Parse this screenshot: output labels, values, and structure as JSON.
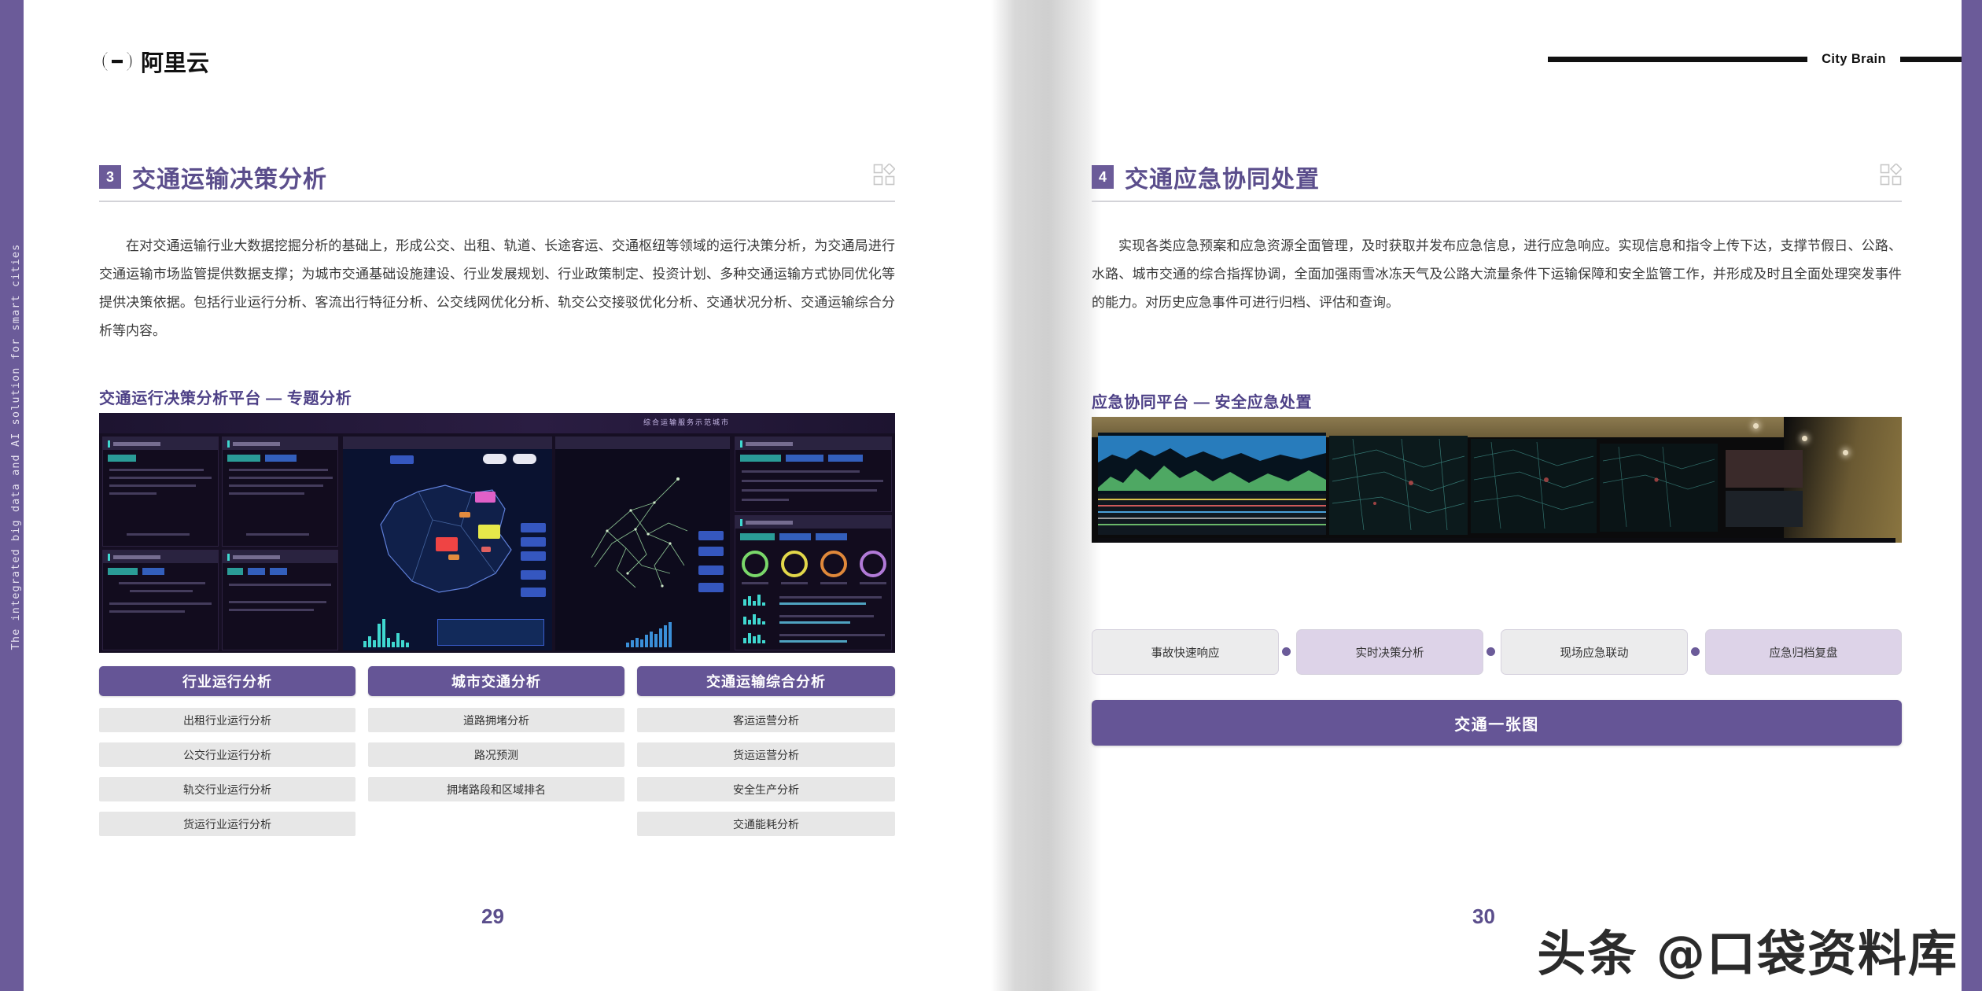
{
  "brand": {
    "logo_text": "阿里云",
    "logo_mark": "alibaba-cloud-logo-icon",
    "header_label": "City Brain",
    "side_rail_text": "The integrated big data and AI solution for smart cities"
  },
  "colors": {
    "purple": "#6B5B99",
    "purple_dark": "#5B4E8C",
    "purple_button": "#655596",
    "lavender": "#DDD3E8",
    "gray_cell": "#E7E7E7",
    "rule": "#D3D3D8"
  },
  "left_page": {
    "section_number": "3",
    "section_title": "交通运输决策分析",
    "grid_icon": "grid-squares-icon",
    "paragraph": "在对交通运输行业大数据挖掘分析的基础上，形成公交、出租、轨道、长途客运、交通枢纽等领域的运行决策分析，为交通局进行交通运输市场监管提供数据支撑；为城市交通基础设施建设、行业发展规划、行业政策制定、投资计划、多种交通运输方式协同优化等提供决策依据。包括行业运行分析、客流出行特征分析、公交线网优化分析、轨交公交接驳优化分析、交通状况分析、交通运输综合分析等内容。",
    "subheading": "交通运行决策分析平台 — 专题分析",
    "screenshot_alt": "交通运行决策分析平台仪表盘截图",
    "columns": [
      {
        "header": "行业运行分析",
        "items": [
          "出租行业运行分析",
          "公交行业运行分析",
          "轨交行业运行分析",
          "货运行业运行分析"
        ]
      },
      {
        "header": "城市交通分析",
        "items": [
          "道路拥堵分析",
          "路况预测",
          "拥堵路段和区域排名"
        ]
      },
      {
        "header": "交通运输综合分析",
        "items": [
          "客运运营分析",
          "货运运营分析",
          "安全生产分析",
          "交通能耗分析"
        ]
      }
    ],
    "page_number": "29"
  },
  "right_page": {
    "section_number": "4",
    "section_title": "交通应急协同处置",
    "grid_icon": "grid-squares-icon",
    "paragraph": "实现各类应急预案和应急资源全面管理，及时获取并发布应急信息，进行应急响应。实现信息和指令上传下达，支撑节假日、公路、水路、城市交通的综合指挥协调，全面加强雨雪冰冻天气及公路大流量条件下运输保障和安全监管工作，并形成及时且全面处理突发事件的能力。对历史应急事件可进行归档、评估和查询。",
    "subheading": "应急协同平台 — 安全应急处置",
    "screenshot_alt": "应急指挥中心大屏照片",
    "pills": [
      {
        "label": "事故快速响应",
        "style": "gray"
      },
      {
        "label": "实时决策分析",
        "style": "lav"
      },
      {
        "label": "现场应急联动",
        "style": "gray"
      },
      {
        "label": "应急归档复盘",
        "style": "lav"
      }
    ],
    "wide_bar": "交通一张图",
    "page_number": "30"
  },
  "watermark": {
    "text": "头条 @口袋资料库"
  }
}
